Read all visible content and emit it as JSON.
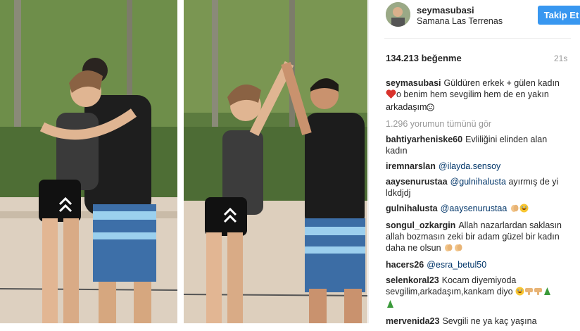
{
  "post": {
    "username": "seymasubasi",
    "location": "Samana Las Terrenas",
    "follow_label": "Takip Et",
    "likes": "134.213 beğenme",
    "time": "21s",
    "caption_user": "seymasubasi",
    "caption_part1": "Güldüren erkek + gülen kadın",
    "caption_part2": "o benim hem sevgilim hem de en yakın arkadaşım",
    "view_all": "1.296 yorumun tümünü gör"
  },
  "comments": [
    {
      "user": "bahtiyarheniske60",
      "text": "Evliliğini elinden alan kadın"
    },
    {
      "user": "iremnarslan",
      "mention": "@ilayda.sensoy"
    },
    {
      "user": "aaysenurustaa",
      "mention": "@gulnihalusta",
      "text": "ayırmış de yi ldkdjdj"
    },
    {
      "user": "gulnihalusta",
      "mention": "@aaysenurustaa"
    },
    {
      "user": "songul_ozkargin",
      "text": "Allah nazarlardan saklasın allah bozmasın zeki bir adam güzel bir kadın daha ne olsun"
    },
    {
      "user": "hacers26",
      "mention": "@esra_betul50"
    },
    {
      "user": "selenkoral23",
      "text": "Kocam diyemiyoda sevgilim,arkadaşım,kankam diyo"
    },
    {
      "user": "mervenida23",
      "text": "Sevgili ne ya kaç yaşına"
    }
  ],
  "colors": {
    "accent": "#3897f0",
    "mention": "#003569",
    "text": "#262626",
    "muted": "#999999"
  }
}
